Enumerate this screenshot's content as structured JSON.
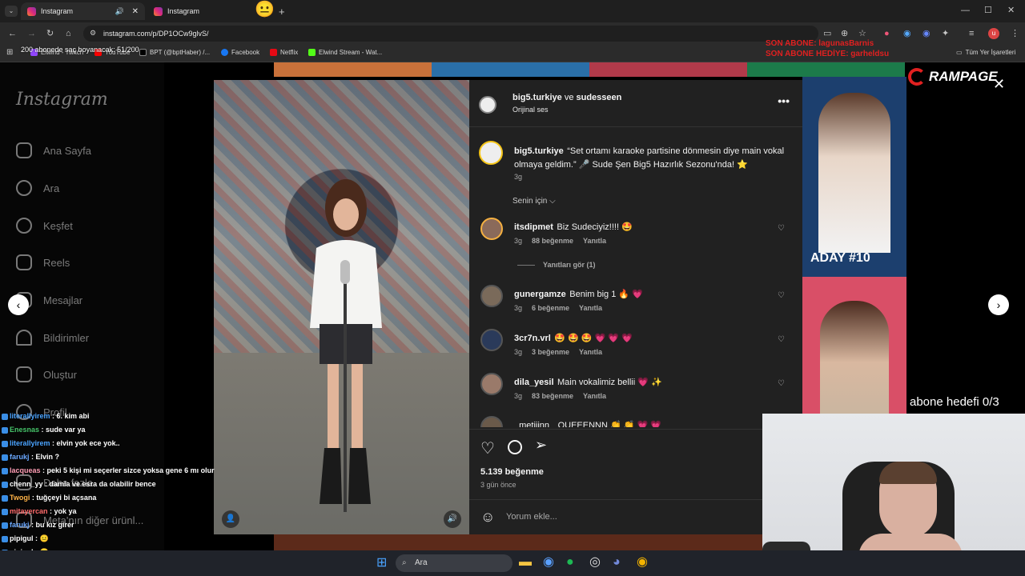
{
  "browser": {
    "tabs": [
      {
        "title": "Instagram",
        "active": true
      },
      {
        "title": "Instagram",
        "active": false
      }
    ],
    "url": "instagram.com/p/DP1OCw9glvS/",
    "bookmarks": [
      "Elwind - Twitch",
      "YouTube",
      "BPT (@bptHaber) /...",
      "Facebook",
      "Netflix",
      "Elwind Stream - Wat..."
    ],
    "all_bookmarks": "Tüm Yer İşaretleri"
  },
  "stream_overlays": {
    "goal_text": "200 abonede saç boyanacak: 51/200",
    "last_sub": "SON ABONE: lagunasBarnis",
    "last_gift": "SON ABONE HEDİYE: garheldsu",
    "brand": "RAMPAGE",
    "sub_goal": "abone hedefi 0/3"
  },
  "instagram": {
    "logo": "Instagram",
    "nav": [
      "Ana Sayfa",
      "Ara",
      "Keşfet",
      "Reels",
      "Mesajlar",
      "Bildirimler",
      "Oluştur",
      "Profil",
      "Daha fazla",
      "Meta'nın diğer ürünl..."
    ],
    "post": {
      "author": "big5.turkiye",
      "and": "ve",
      "coauthor": "sudesseen",
      "audio": "Orijinal ses",
      "caption_user": "big5.turkiye",
      "caption": "“Set ortamı karaoke partisine dönmesin diye main vokal olmaya geldim.” 🎤 Sude Şen Big5 Hazırlık Sezonu'nda! ⭐",
      "caption_time": "3g",
      "for_you": "Senin için ⌵",
      "likes": "5.139 beğenme",
      "date": "3 gün önce",
      "add_comment": "Yorum ekle..."
    },
    "comments": [
      {
        "user": "itsdipmet",
        "text": "Biz Sudeciyiz!!!! 🤩",
        "time": "3g",
        "likes": "88 beğenme",
        "reply": "Yanıtla",
        "view_replies": "Yanıtları gör (1)"
      },
      {
        "user": "gunergamze",
        "text": "Benim big 1 🔥 💗",
        "time": "3g",
        "likes": "6 beğenme",
        "reply": "Yanıtla"
      },
      {
        "user": "3cr7n.vrl",
        "text": "🤩 🤩 🤩 💗 💗 💗",
        "time": "3g",
        "likes": "3 beğenme",
        "reply": "Yanıtla"
      },
      {
        "user": "dila_yesil",
        "text": "Main vokalimiz bellii 💗 ✨",
        "time": "3g",
        "likes": "83 beğenme",
        "reply": "Yanıtla"
      },
      {
        "user": "_metiiinn_",
        "text": "QUEEENNN 👏 👏 💗 💗"
      }
    ],
    "background_card": "ADAY #10"
  },
  "chat": [
    {
      "user": "literallyirem",
      "msg": "6. kim abi",
      "color": "#4aa3ff"
    },
    {
      "user": "Enesnas",
      "msg": "sude var ya",
      "color": "#46c46a"
    },
    {
      "user": "literallyirem",
      "msg": "elvin yok ece yok..",
      "color": "#4aa3ff"
    },
    {
      "user": "farukj",
      "msg": "Elvin ?",
      "color": "#6aa8ff"
    },
    {
      "user": "lacqueas",
      "msg": "peki 5 kişi mi seçerler sizce yoksa gene 6 mı olur",
      "color": "#ff9db4"
    },
    {
      "user": "chenn_yy",
      "msg": "damla ve esra da olabilir bence",
      "color": "#ffffff"
    },
    {
      "user": "Twogi",
      "msg": "tuğçeyi bi açsana",
      "color": "#ffb347"
    },
    {
      "user": "mitayercan",
      "msg": "yok ya",
      "color": "#ff6b6b"
    },
    {
      "user": "farukj",
      "msg": "bu kız girer",
      "color": "#6aa8ff"
    },
    {
      "user": "pipigul",
      "msg": "😐",
      "color": "#ffffff"
    },
    {
      "user": "pipigul",
      "msg": "😐",
      "color": "#ffffff"
    },
    {
      "user": "pipigul",
      "msg": "😐",
      "color": "#ffffff"
    }
  ],
  "taskbar": {
    "search": "Ara"
  }
}
